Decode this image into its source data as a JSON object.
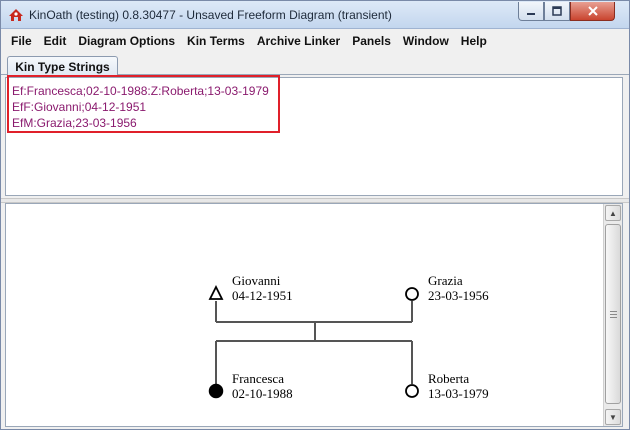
{
  "window": {
    "title": "KinOath (testing) 0.8.30477 - Unsaved Freeform Diagram (transient)",
    "icon": "kinoath-app-icon",
    "controls": [
      "minimize-icon",
      "maximize-icon",
      "close-icon"
    ]
  },
  "menu": {
    "items": [
      "File",
      "Edit",
      "Diagram Options",
      "Kin Terms",
      "Archive Linker",
      "Panels",
      "Window",
      "Help"
    ]
  },
  "tabs": [
    {
      "label": "Kin Type Strings",
      "selected": true
    }
  ],
  "kin_type_strings": {
    "lines": [
      "Ef:Francesca;02-10-1988:Z:Roberta;13-03-1979",
      "EfF:Giovanni;04-12-1951",
      "EfM:Grazia;23-03-1956"
    ],
    "text_color": "#8a1a6e",
    "highlight_color": "#e0202a"
  },
  "diagram": {
    "people": [
      {
        "name": "Giovanni",
        "date": "04-12-1951",
        "symbol": "male-triangle"
      },
      {
        "name": "Grazia",
        "date": "23-03-1956",
        "symbol": "female-circle"
      },
      {
        "name": "Francesca",
        "date": "02-10-1988",
        "symbol": "female-circle-filled-ego"
      },
      {
        "name": "Roberta",
        "date": "13-03-1979",
        "symbol": "female-circle"
      }
    ]
  },
  "colors": {
    "titlebar": "#c3d6ee",
    "close_button": "#c9442f"
  }
}
